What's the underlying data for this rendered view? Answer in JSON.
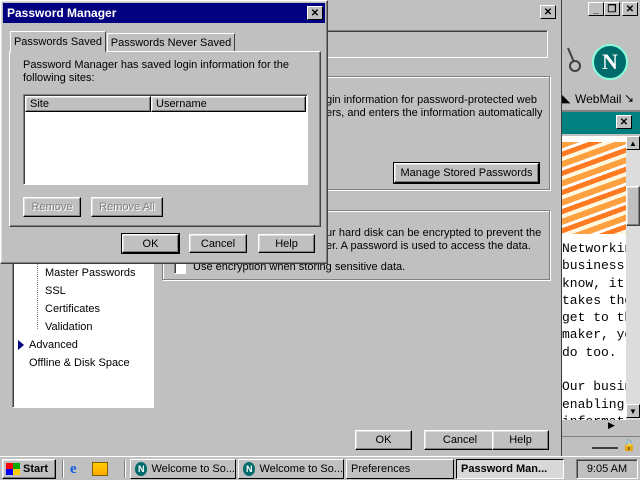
{
  "browser": {
    "nav_webmail": "WebMail"
  },
  "preferences": {
    "tree": {
      "master_passwords": "Master Passwords",
      "ssl": "SSL",
      "certificates": "Certificates",
      "validation": "Validation",
      "advanced": "Advanced",
      "offline": "Offline & Disk Space"
    },
    "password_text_line1": "gin information for password-protected web",
    "password_text_line2": "ers, and enters the information automatically",
    "manage_button": "Manage Stored Passwords",
    "encrypt_text_line1": "ur hard disk can be encrypted to prevent the",
    "encrypt_text_line2": "er. A password is used to access the data.",
    "encrypt_checkbox_label": "Use encryption when storing sensitive data.",
    "ok": "OK",
    "cancel": "Cancel",
    "help": "Help"
  },
  "page_content": {
    "lines": [
      "Networking",
      "business.",
      "know, it's",
      "takes the",
      "get to th",
      "maker, yo",
      "do too.",
      "",
      "Our busin",
      "enabling",
      "informatio"
    ]
  },
  "dialog": {
    "title": "Password Manager",
    "tabs": [
      "Passwords Saved",
      "Passwords Never Saved"
    ],
    "description": "Password Manager has saved login information for the following sites:",
    "columns": [
      "Site",
      "Username"
    ],
    "rows": [],
    "remove": "Remove",
    "remove_all": "Remove All",
    "ok": "OK",
    "cancel": "Cancel",
    "help": "Help"
  },
  "taskbar": {
    "start": "Start",
    "tasks": [
      "Welcome to So...",
      "Welcome to So...",
      "Preferences",
      "Password Man..."
    ],
    "clock": "9:05 AM"
  }
}
